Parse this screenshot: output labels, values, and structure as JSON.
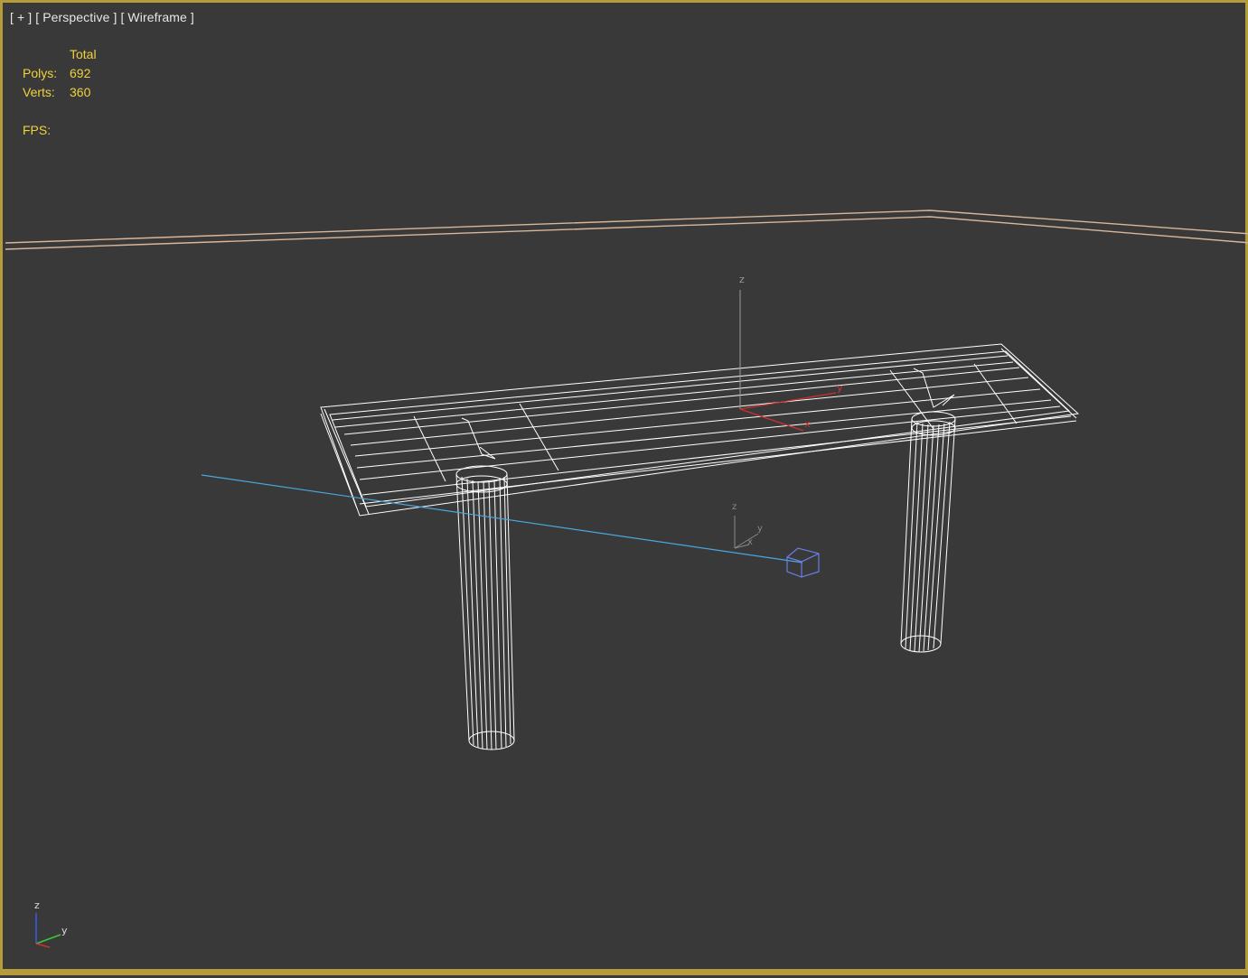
{
  "viewport": {
    "label_plus": "[ + ]",
    "label_view": "[ Perspective ]",
    "label_shading": "[ Wireframe ]"
  },
  "stats": {
    "header": "Total",
    "polys_label": "Polys:",
    "polys_value": "692",
    "verts_label": "Verts:",
    "verts_value": "360",
    "fps_label": "FPS:"
  },
  "gizmo": {
    "z": "z",
    "y": "y",
    "x": "x"
  },
  "icons": {
    "object_pivot": "pivot-gizmo-icon",
    "light": "light-icon",
    "world_axis": "world-axis-icon"
  },
  "colors": {
    "frame": "#b49b3c",
    "background": "#393939",
    "stats_text": "#f0d23c",
    "wire": "#ffffff",
    "wall": "#d8b69a",
    "target_line": "#4aa6e0",
    "light_box": "#6b7fe6",
    "gizmo_x": "#d23030"
  }
}
